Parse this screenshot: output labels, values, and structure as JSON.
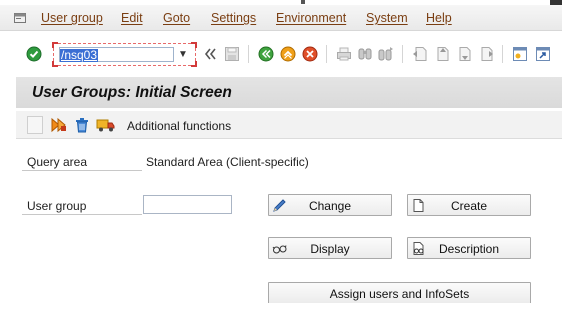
{
  "menubar": {
    "items": [
      {
        "label": "User group"
      },
      {
        "label": "Edit"
      },
      {
        "label": "Goto"
      },
      {
        "label": "Settings"
      },
      {
        "label": "Environment"
      },
      {
        "label": "System"
      },
      {
        "label": "Help"
      }
    ]
  },
  "toolbar": {
    "command_value": "/nsq03",
    "icons": [
      "enter-check-icon",
      "history-back-icon",
      "back-icon",
      "exit-icon",
      "cancel-icon",
      "print-icon",
      "find-icon",
      "find-next-icon",
      "first-page-icon",
      "previous-page-icon",
      "next-page-icon",
      "last-page-icon",
      "create-session-icon",
      "shortcut-icon"
    ]
  },
  "title": {
    "text": "User Groups: Initial Screen"
  },
  "app_toolbar": {
    "additional_functions": "Additional functions"
  },
  "form": {
    "query_area_label": "Query area",
    "query_area_value": "Standard Area (Client-specific)",
    "user_group_label": "User group",
    "user_group_value": ""
  },
  "buttons": {
    "change": "Change",
    "create": "Create",
    "display": "Display",
    "description": "Description",
    "assign": "Assign users and InfoSets"
  },
  "colors": {
    "menu_text": "#7a3e12",
    "title_bg": "#dadada",
    "selection": "#3b6fd4"
  }
}
